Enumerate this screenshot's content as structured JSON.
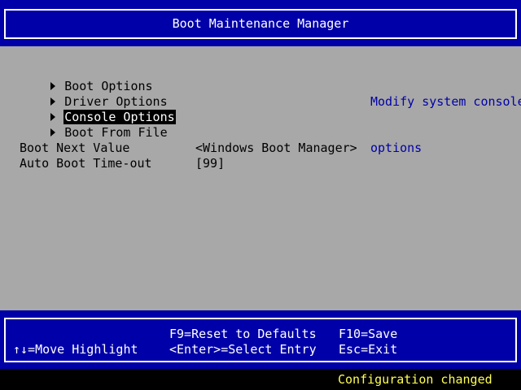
{
  "title": "Boot Maintenance Manager",
  "menu": {
    "items": [
      {
        "label": "Boot Options",
        "selected": false
      },
      {
        "label": "Driver Options",
        "selected": false
      },
      {
        "label": "Console Options",
        "selected": true
      },
      {
        "label": "Boot From File",
        "selected": false
      }
    ]
  },
  "fields": [
    {
      "label": "Boot Next Value",
      "value": "<Windows Boot Manager>"
    },
    {
      "label": "Auto Boot Time-out",
      "value": "[99]"
    }
  ],
  "help": {
    "line1": "Modify system console",
    "line2": "options"
  },
  "footer": {
    "reset": "F9=Reset to Defaults",
    "save": "F10=Save",
    "move": "↑↓=Move Highlight",
    "select": "<Enter>=Select Entry",
    "exit": "Esc=Exit"
  },
  "status": "Configuration changed",
  "colors": {
    "frame_blue": "#0000a8",
    "panel_gray": "#a8a8a8",
    "help_blue": "#0000a8",
    "status_yellow": "#ffff55"
  }
}
